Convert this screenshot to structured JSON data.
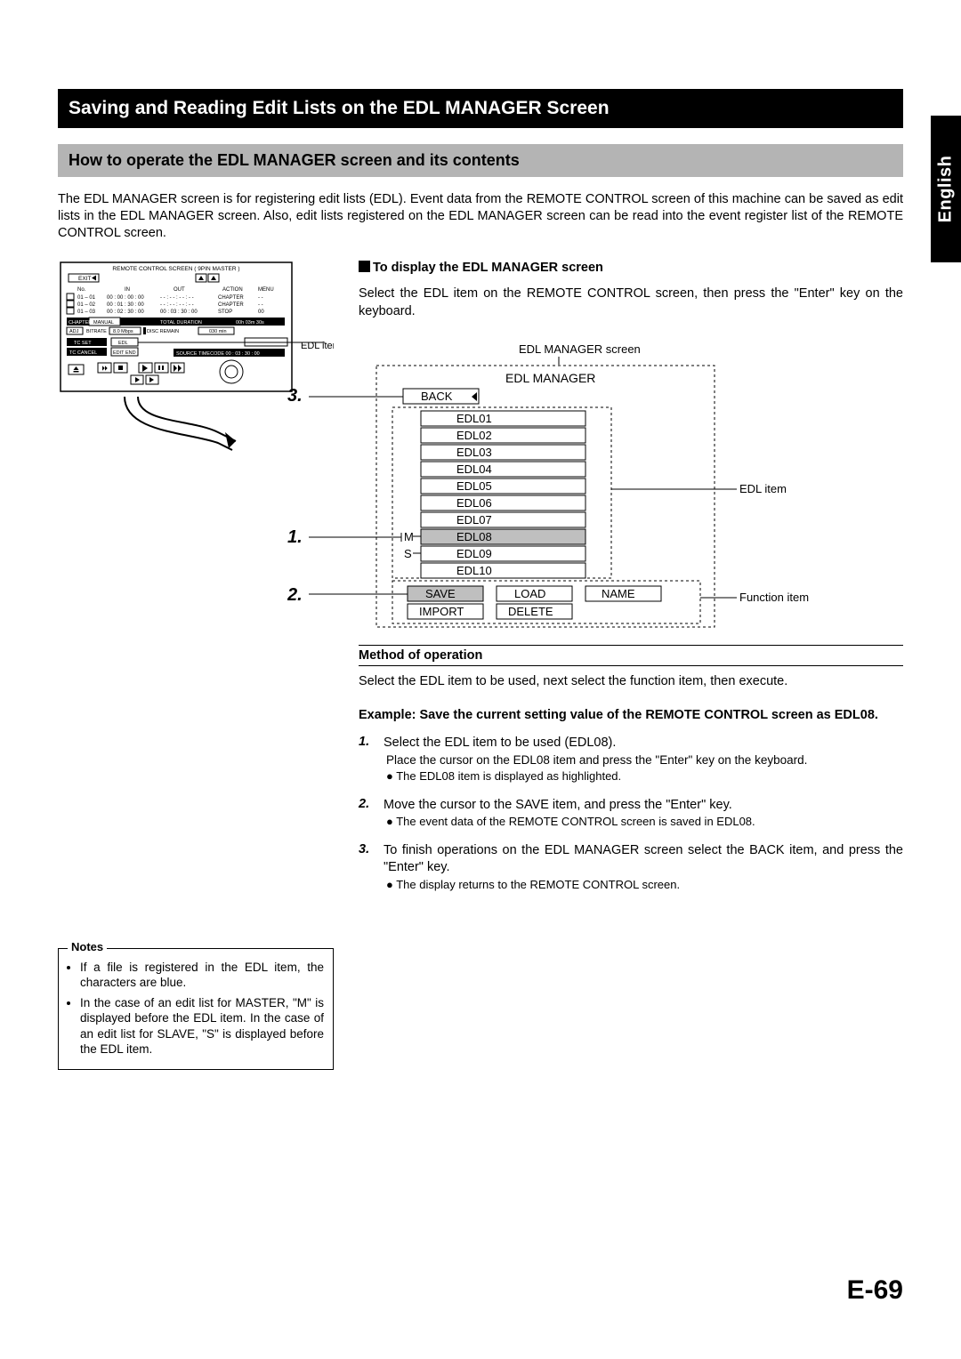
{
  "lang": "English",
  "title": "Saving and Reading Edit Lists on the EDL MANAGER Screen",
  "subtitle": "How to operate the EDL MANAGER screen and its contents",
  "intro": "The EDL MANAGER screen is for registering edit lists (EDL). Event data from the REMOTE CONTROL screen of this machine can be saved as edit lists in the EDL MANAGER screen. Also, edit lists registered on the EDL MANAGER screen can be read into the event register list of the REMOTE CONTROL screen.",
  "display_heading": "To display the EDL MANAGER screen",
  "display_body": "Select the EDL item on the REMOTE CONTROL screen, then press the \"Enter\" key on the keyboard.",
  "method_heading": "Method of operation",
  "method_body": "Select the EDL item to be used, next select the function item, then execute.",
  "example_heading": "Example: Save the current setting value of the REMOTE CONTROL screen as EDL08.",
  "steps": [
    {
      "n": "1.",
      "main": "Select the EDL item to be used (EDL08).",
      "s1": "Place the cursor on the EDL08 item and press the \"Enter\" key on the keyboard.",
      "s2": "● The EDL08 item is displayed as highlighted."
    },
    {
      "n": "2.",
      "main": "Move the cursor to the SAVE item, and press the \"Enter\" key.",
      "s1": "● The event data of the REMOTE CONTROL screen is saved in EDL08."
    },
    {
      "n": "3.",
      "main": "To finish operations on the EDL MANAGER screen select the BACK item, and press the \"Enter\" key.",
      "s1": "● The display returns to the REMOTE CONTROL screen."
    }
  ],
  "notes_title": "Notes",
  "notes": [
    "If a file is registered in the EDL item, the characters are blue.",
    "In the case of an edit list for MASTER, \"M\" is displayed before the EDL item. In the case of an edit list for SLAVE, \"S\" is displayed before the EDL item."
  ],
  "page_number": "E-69",
  "edl_screen": {
    "title": "EDL MANAGER",
    "back": "BACK",
    "items": [
      "EDL01",
      "EDL02",
      "EDL03",
      "EDL04",
      "EDL05",
      "EDL06",
      "EDL07",
      "EDL08",
      "EDL09",
      "EDL10"
    ],
    "m": "M",
    "s": "S",
    "fn": [
      "SAVE",
      "LOAD",
      "NAME",
      "IMPORT",
      "DELETE"
    ]
  },
  "labels": {
    "rc_edl_item": "EDL item",
    "edl_screen_label": "EDL MANAGER screen",
    "edl_item": "EDL item",
    "fn_item": "Function item",
    "p1": "1.",
    "p2": "2.",
    "p3": "3."
  },
  "rc": {
    "title": "REMOTE CONTROL SCREEN   ( 9PIN MASTER )",
    "exit": "EXIT",
    "hdr": [
      "No.",
      "IN",
      "OUT",
      "ACTION",
      "MENU"
    ],
    "rows": [
      [
        "01 – 01",
        "00 : 00 : 00 : 00",
        "- - : - - : - - : - -",
        "CHAPTER",
        "- -"
      ],
      [
        "01 – 02",
        "00 : 01 : 30 : 00",
        "- - : - - : - - : - -",
        "CHAPTER",
        "- -"
      ],
      [
        "01 – 03",
        "00 : 02 : 30 : 00",
        "00 : 03 : 30 : 00",
        "STOP",
        "00"
      ]
    ],
    "footer1": [
      "CHAPTER",
      "MANUAL",
      "TOTAL DURATION",
      "00h 03m 30s"
    ],
    "footer2": [
      "ADJ",
      "BITRATE",
      "8.0  Mbps",
      "DISC  REMAIN",
      "030  min"
    ],
    "tc_set": "TC  SET",
    "edl": "EDL",
    "tc_cancel": "TC  CANCEL",
    "edit_end": "EDIT END",
    "src": "SOURCE  TIMECODE     00 : 03 : 30 : 00"
  }
}
